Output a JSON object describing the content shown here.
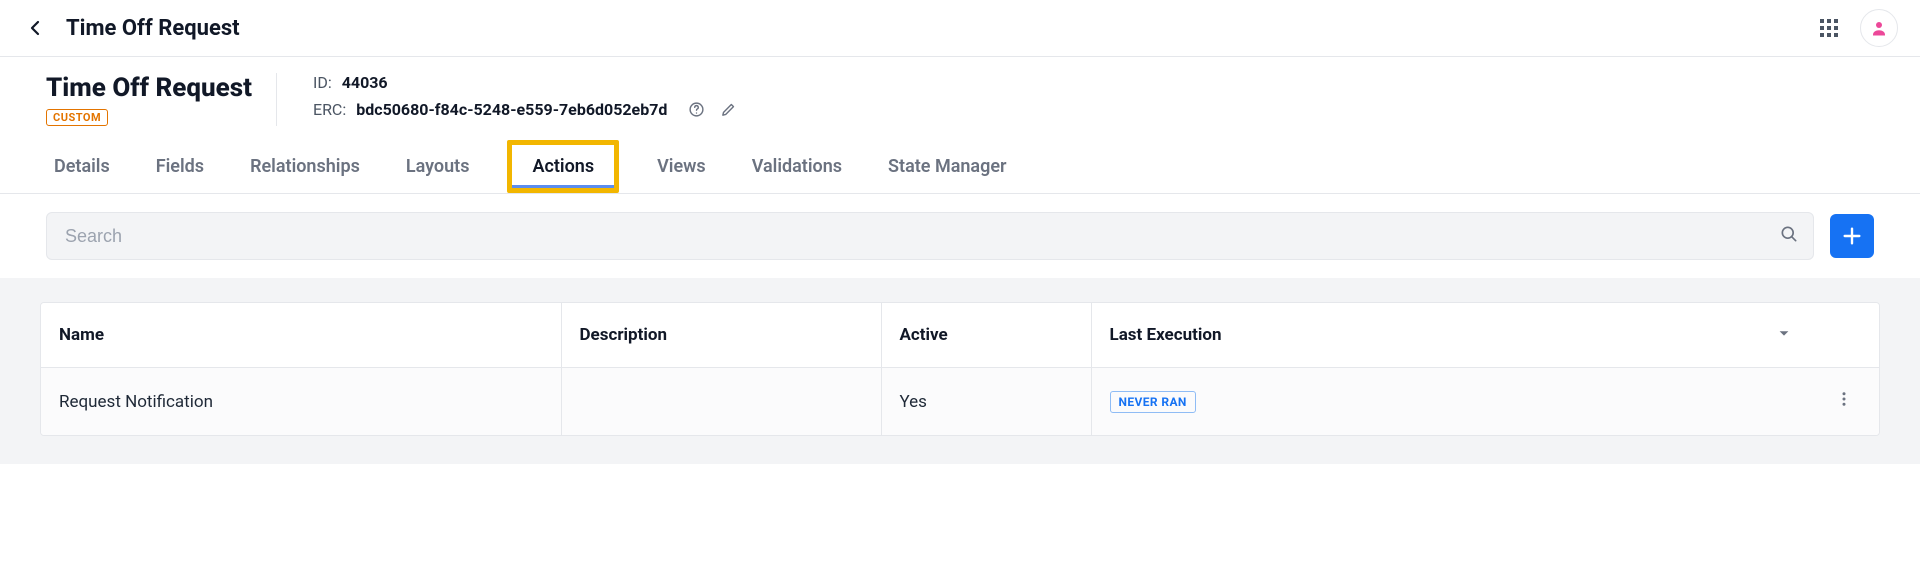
{
  "topbar": {
    "title": "Time Off Request"
  },
  "object": {
    "title": "Time Off Request",
    "badge": "CUSTOM",
    "id_label": "ID:",
    "id_value": "44036",
    "erc_label": "ERC:",
    "erc_value": "bdc50680-f84c-5248-e559-7eb6d052eb7d"
  },
  "tabs": [
    {
      "label": "Details",
      "active": false
    },
    {
      "label": "Fields",
      "active": false
    },
    {
      "label": "Relationships",
      "active": false
    },
    {
      "label": "Layouts",
      "active": false
    },
    {
      "label": "Actions",
      "active": true
    },
    {
      "label": "Views",
      "active": false
    },
    {
      "label": "Validations",
      "active": false
    },
    {
      "label": "State Manager",
      "active": false
    }
  ],
  "search": {
    "placeholder": "Search"
  },
  "table": {
    "columns": {
      "name": "Name",
      "description": "Description",
      "active": "Active",
      "last_execution": "Last Execution"
    },
    "rows": [
      {
        "name": "Request Notification",
        "description": "",
        "active": "Yes",
        "last_execution_badge": "NEVER RAN"
      }
    ]
  }
}
